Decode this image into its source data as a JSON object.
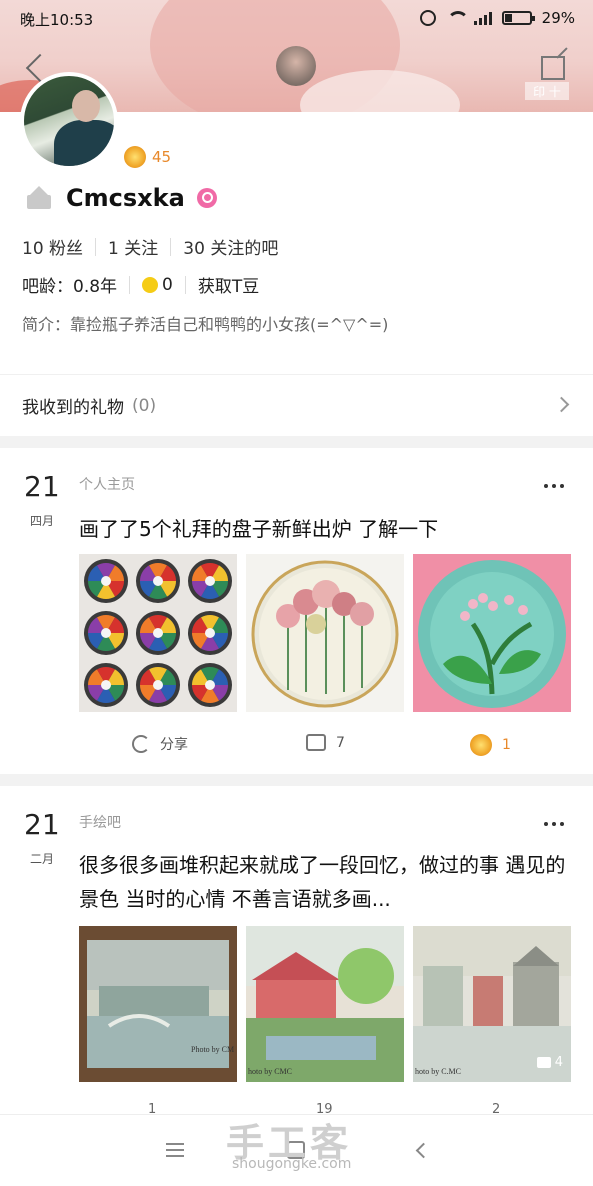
{
  "status_bar": {
    "time": "晚上10:53",
    "battery": "29%",
    "battery_level": 0.29
  },
  "header": {
    "stamp_text": "印 十"
  },
  "profile": {
    "level": "45",
    "username": "Cmcsxka",
    "stats": {
      "fans": "10 粉丝",
      "following": "1 关注",
      "forums": "30 关注的吧"
    },
    "age_label": "吧龄：0.8年",
    "t_beans": "0",
    "get_beans": "获取T豆",
    "intro": "简介：靠捡瓶子养活自己和鸭鸭的小女孩(=^▽^=)"
  },
  "gifts": {
    "label": "我收到的礼物",
    "count": "(0)"
  },
  "posts": [
    {
      "day": "21",
      "month": "四月",
      "forum": "个人主页",
      "title": "画了了5个礼拜的盘子新鲜出炉 了解一下",
      "share": "分享",
      "comments": "7",
      "likes": "1"
    },
    {
      "day": "21",
      "month": "二月",
      "forum": "手绘吧",
      "title": "很多很多画堆积起来就成了一段回忆，做过的事 遇见的景色 当时的心情 不善言语就多画...",
      "image_count": "4",
      "photo_credit_1": "Photo by CM",
      "photo_credit_2": "hoto by CMC",
      "photo_credit_3": "hoto by C.MC",
      "share_peek": "1",
      "comments_peek": "19",
      "likes_peek": "2"
    }
  ],
  "watermark": {
    "brand": "手工客",
    "url": "shougongke.com"
  },
  "colors": {
    "accent_orange": "#e8892b",
    "female_pink": "#f06aa6",
    "bean_yellow": "#f5cc16"
  }
}
